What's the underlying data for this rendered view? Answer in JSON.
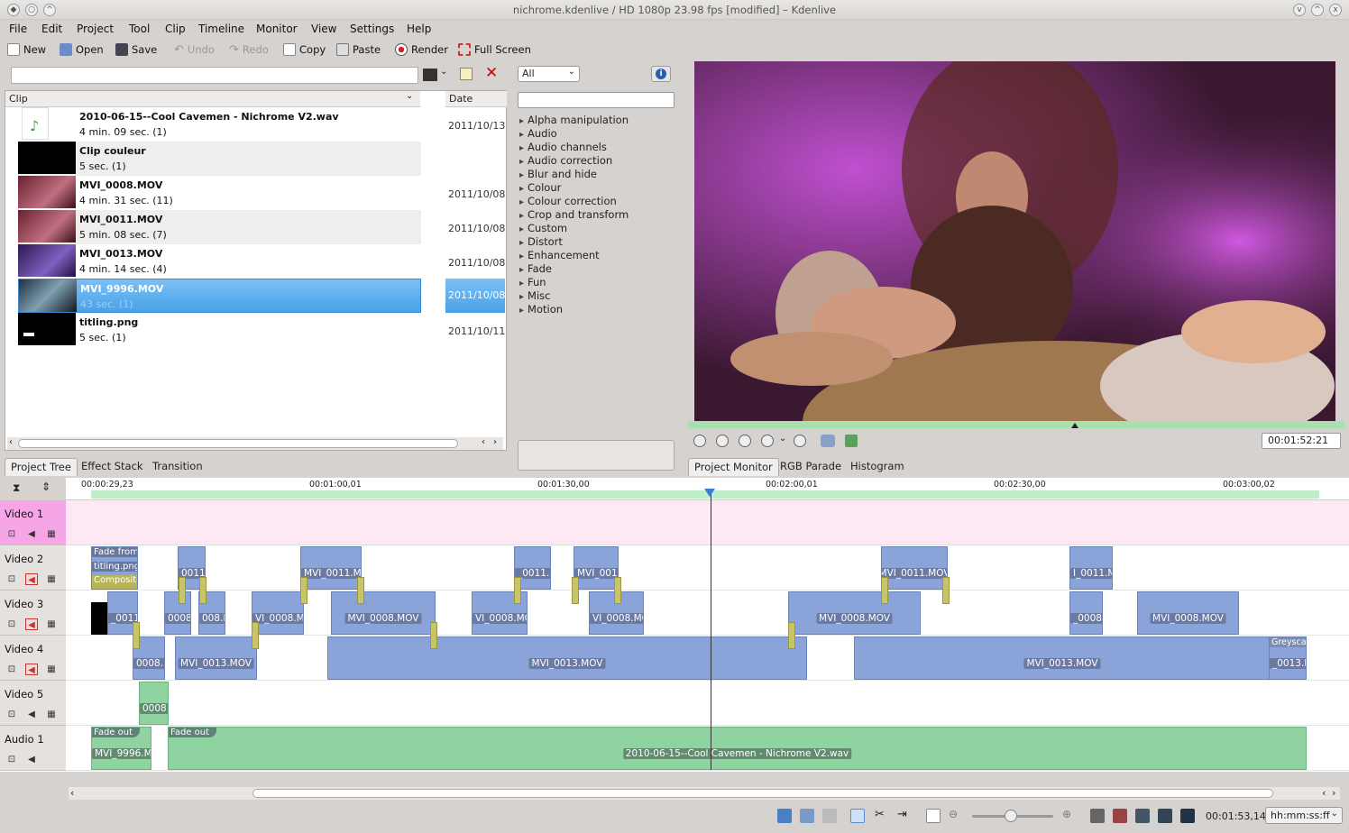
{
  "window": {
    "title": "nichrome.kdenlive / HD 1080p 23.98 fps [modified] – Kdenlive"
  },
  "menu": [
    "File",
    "Edit",
    "Project",
    "Tool",
    "Clip",
    "Timeline",
    "Monitor",
    "View",
    "Settings",
    "Help"
  ],
  "toolbar": {
    "new": "New",
    "open": "Open",
    "save": "Save",
    "undo": "Undo",
    "redo": "Redo",
    "copy": "Copy",
    "paste": "Paste",
    "render": "Render",
    "fullscreen": "Full Screen"
  },
  "project_tree": {
    "headers": {
      "clip": "Clip",
      "date": "Date"
    },
    "clips": [
      {
        "name": "2010-06-15--Cool Cavemen - Nichrome V2.wav",
        "duration": "4 min. 09 sec. (1)",
        "date": "2011/10/13",
        "thumb": "audio"
      },
      {
        "name": "Clip couleur",
        "duration": "5 sec. (1)",
        "date": "",
        "thumb": "black"
      },
      {
        "name": "MVI_0008.MOV",
        "duration": "4 min. 31 sec. (11)",
        "date": "2011/10/08",
        "thumb": "video"
      },
      {
        "name": "MVI_0011.MOV",
        "duration": "5 min. 08 sec. (7)",
        "date": "2011/10/08",
        "thumb": "video"
      },
      {
        "name": "MVI_0013.MOV",
        "duration": "4 min. 14 sec. (4)",
        "date": "2011/10/08",
        "thumb": "video2"
      },
      {
        "name": "MVI_9996.MOV",
        "duration": "43 sec. (1)",
        "date": "2011/10/08",
        "thumb": "video3",
        "selected": true
      },
      {
        "name": "titling.png",
        "duration": "5 sec. (1)",
        "date": "2011/10/11",
        "thumb": "title"
      }
    ]
  },
  "effects": {
    "filter": "All",
    "categories": [
      "Alpha manipulation",
      "Audio",
      "Audio channels",
      "Audio correction",
      "Blur and hide",
      "Colour",
      "Colour correction",
      "Crop and transform",
      "Custom",
      "Distort",
      "Enhancement",
      "Fade",
      "Fun",
      "Misc",
      "Motion"
    ]
  },
  "bottom_tabs_left": [
    "Project Tree",
    "Effect Stack",
    "Transition"
  ],
  "monitor": {
    "timecode": "00:01:52:21",
    "tabs": [
      "Project Monitor",
      "RGB Parade",
      "Histogram"
    ]
  },
  "timeline": {
    "ruler": [
      "00:00:29,23",
      "00:01:00,01",
      "00:01:30,00",
      "00:02:00,01",
      "00:02:30,00",
      "00:03:00,02"
    ],
    "tracks": [
      "Video 1",
      "Video 2",
      "Video 3",
      "Video 4",
      "Video 5",
      "Audio 1"
    ],
    "clip_labels": {
      "fade_from": "Fade from",
      "titling": "titling.png",
      "composite": "Composite",
      "mvi11_short": "0011.",
      "mvi11_a": "MVI_0011.MOV",
      "mvi11_b": "_0011.M",
      "mvi11_c": "MVI_0011.MC",
      "mvi11_d": "MVI_0011.MOV",
      "mvi11_e": "I_0011.M",
      "v3_a": "_0011.I",
      "v3_b": "0008.",
      "v3_c": "008.I",
      "v3_d": "VI_0008.MC",
      "v3_e": "MVI_0008.MOV",
      "v3_f": "VI_0008.MO",
      "v3_g": "VI_0008.MO",
      "v3_h": "MVI_0008.MOV",
      "v3_i": "_0008.M",
      "v3_j": "MVI_0008.MOV",
      "v4_a": "0008.I",
      "v4_b": "MVI_0013.MOV",
      "v4_c": "MVI_0013.MOV",
      "v4_d": "MVI_0013.MOV",
      "v4_grey": "Greysca",
      "v4_e": "_0013.M",
      "v5_a": "0008.M",
      "fade_out": "Fade out",
      "aud_a": "MVI_9996.MO",
      "aud_main": "2010-06-15--Cool Cavemen - Nichrome V2.wav"
    }
  },
  "status": {
    "timecode": "00:01:53,14",
    "format": "hh:mm:ss:ff"
  }
}
